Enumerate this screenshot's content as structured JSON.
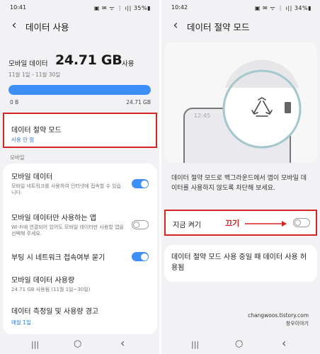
{
  "left": {
    "status": {
      "time": "10:41",
      "icons": "▣ ✉ ᯤ ⋮ ı|| 35%▮"
    },
    "header": {
      "back_icon": "‹",
      "title": "데이터 사용"
    },
    "usage": {
      "label": "모바일 데이터",
      "amount": "24.71 GB",
      "unit": "사용",
      "range": "11월 1일 - 11월 30일",
      "fill_fraction": 1.0,
      "bar_min": "0 B",
      "bar_max": "24.71 GB"
    },
    "data_saver": {
      "title": "데이터 절약 모드",
      "status": "사용 안 함"
    },
    "section_title": "모바일",
    "settings": [
      {
        "title": "모바일 데이터",
        "desc": "모바일 네트워크를 사용하여 인터넷에 접속할 수 있습니다.",
        "toggle": true
      },
      {
        "title": "모바일 데이터만 사용하는 앱",
        "desc": "Wi-Fi에 연결되어 있어도 모바일 데이터만 사용할 앱을 선택해 주세요.",
        "toggle": false
      },
      {
        "title": "부팅 시 네트워크 접속여부 묻기",
        "toggle": true
      },
      {
        "title": "모바일 데이터 사용량",
        "desc": "24.71 GB 사용됨 (11월 1일~30일)"
      },
      {
        "title": "데이터 측정일 및 사용량 경고",
        "sub": "매월 1일"
      }
    ],
    "nav": {
      "recent": "|||",
      "home": "○",
      "back": "‹"
    }
  },
  "right": {
    "status": {
      "time": "10:42",
      "icons": "▣ ✉ ᯤ ⋮ ı|| 34%▮"
    },
    "header": {
      "back_icon": "‹",
      "title": "데이터 절약 모드"
    },
    "illustration": {
      "clock": "12:45"
    },
    "description": "데이터 절약 모드로 백그라운드에서 앱이 모바일 데이터를 사용하지 않도록 차단해 보세요.",
    "turn_on": {
      "label": "지금 켜기",
      "annotation": "끄기",
      "toggle": false
    },
    "allowed_label": "데이터 절약 모드 사용 중일 때 데이터 사용 허용됨",
    "watermark": {
      "site": "changwoos.tistory.com",
      "name": "창우이야기"
    },
    "nav": {
      "recent": "|||",
      "home": "○",
      "back": "‹"
    }
  },
  "colors": {
    "accent": "#3e8ef7",
    "highlight": "#d52424",
    "link": "#2f7bd9"
  }
}
